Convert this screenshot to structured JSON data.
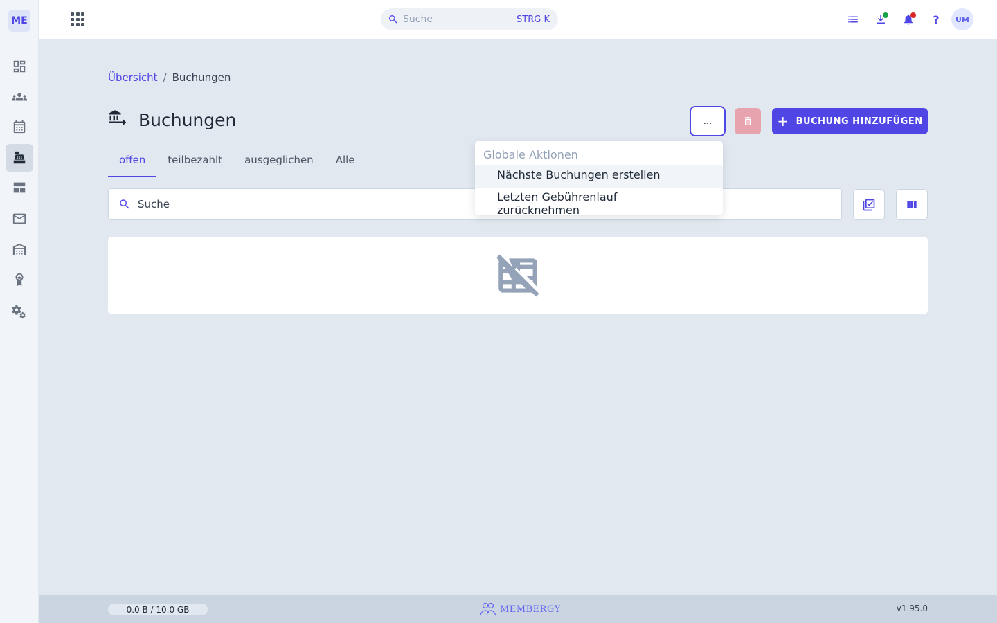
{
  "app": {
    "logo_text": "ME"
  },
  "topbar": {
    "search_placeholder": "Suche",
    "search_shortcut": "STRG K",
    "help_label": "?",
    "avatar_initials": "UM",
    "download_dot_color": "#16a34a",
    "notification_dot_color": "#dc2626"
  },
  "sidebar": {
    "items": [
      {
        "icon": "dashboard-icon",
        "active": false
      },
      {
        "icon": "members-icon",
        "active": false
      },
      {
        "icon": "calendar-icon",
        "active": false
      },
      {
        "icon": "cash-register-icon",
        "active": true
      },
      {
        "icon": "table-view-icon",
        "active": false
      },
      {
        "icon": "mail-icon",
        "active": false
      },
      {
        "icon": "warehouse-icon",
        "active": false
      },
      {
        "icon": "award-icon",
        "active": false
      },
      {
        "icon": "settings-icon",
        "active": false
      }
    ]
  },
  "breadcrumb": {
    "parent": "Übersicht",
    "separator": "/",
    "current": "Buchungen"
  },
  "page": {
    "title": "Buchungen",
    "more_label": "...",
    "add_label": "BUCHUNG HINZUFÜGEN"
  },
  "tabs": [
    {
      "label": "offen",
      "active": true
    },
    {
      "label": "teilbezahlt",
      "active": false
    },
    {
      "label": "ausgeglichen",
      "active": false
    },
    {
      "label": "Alle",
      "active": false
    }
  ],
  "list": {
    "search_placeholder": "Suche",
    "empty_icon": "no-data-table-icon"
  },
  "dropdown": {
    "header": "Globale Aktionen",
    "items": [
      "Nächste Buchungen erstellen",
      "Letzten Gebührenlauf zurücknehmen"
    ]
  },
  "footer": {
    "storage": "0.0 B / 10.0 GB",
    "brand": "MEMBERGY",
    "version": "v1.95.0"
  },
  "colors": {
    "accent": "#4f46e5",
    "danger_disabled": "#e8a4ae"
  }
}
